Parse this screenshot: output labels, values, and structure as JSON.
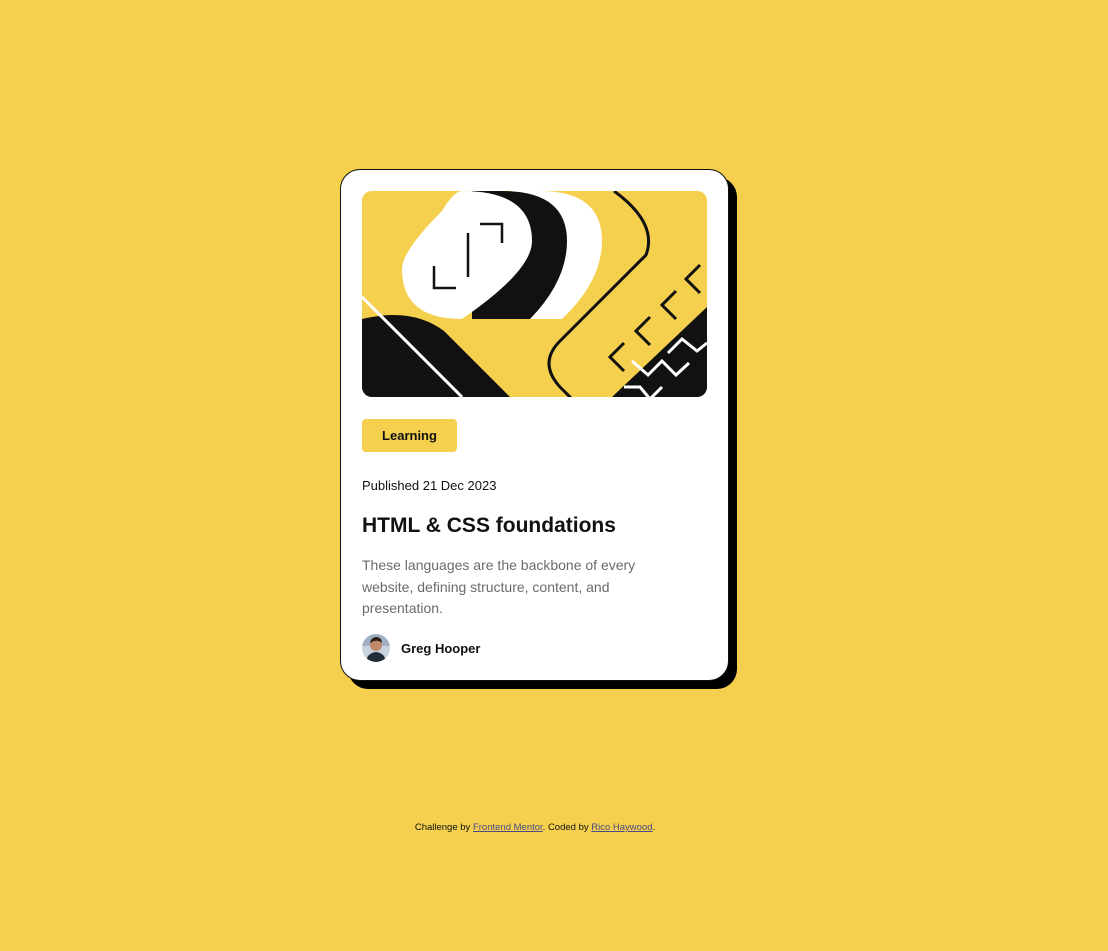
{
  "colors": {
    "background": "#F4D04E",
    "card": "#FFFFFF",
    "text": "#111111",
    "muted": "#6B6B6B",
    "shadow": "#000000"
  },
  "card": {
    "hero_image": "abstract-illustration",
    "tag": "Learning",
    "published": "Published 21 Dec 2023",
    "title": "HTML & CSS foundations",
    "description": "These languages are the backbone of every website, defining structure, content, and presentation.",
    "author": {
      "name": "Greg Hooper",
      "avatar_icon": "avatar-photo"
    }
  },
  "footer": {
    "prefix": "Challenge by ",
    "challenge_link": "Frontend Mentor",
    "middle": ". Coded by ",
    "author_link": "Rico Haywood",
    "suffix": "."
  }
}
